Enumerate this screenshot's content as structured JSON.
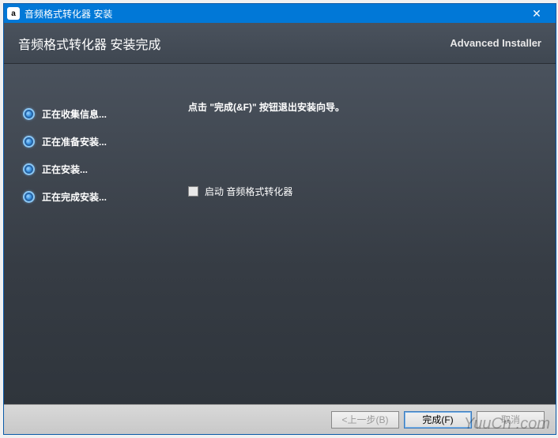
{
  "titlebar": {
    "icon_letter": "a",
    "title": "音频格式转化器 安装",
    "close": "✕"
  },
  "header": {
    "title": "音频格式转化器 安装完成",
    "brand": "Advanced Installer"
  },
  "steps": [
    {
      "label": "正在收集信息..."
    },
    {
      "label": "正在准备安装..."
    },
    {
      "label": "正在安装..."
    },
    {
      "label": "正在完成安装..."
    }
  ],
  "content": {
    "instruction": "点击 \"完成(&F)\" 按钮退出安装向导。",
    "launch_checkbox_label": "启动 音频格式转化器"
  },
  "footer": {
    "back": "<上一步(B)",
    "finish": "完成(F)",
    "cancel": "取消"
  },
  "watermark": "YuuCn .com"
}
